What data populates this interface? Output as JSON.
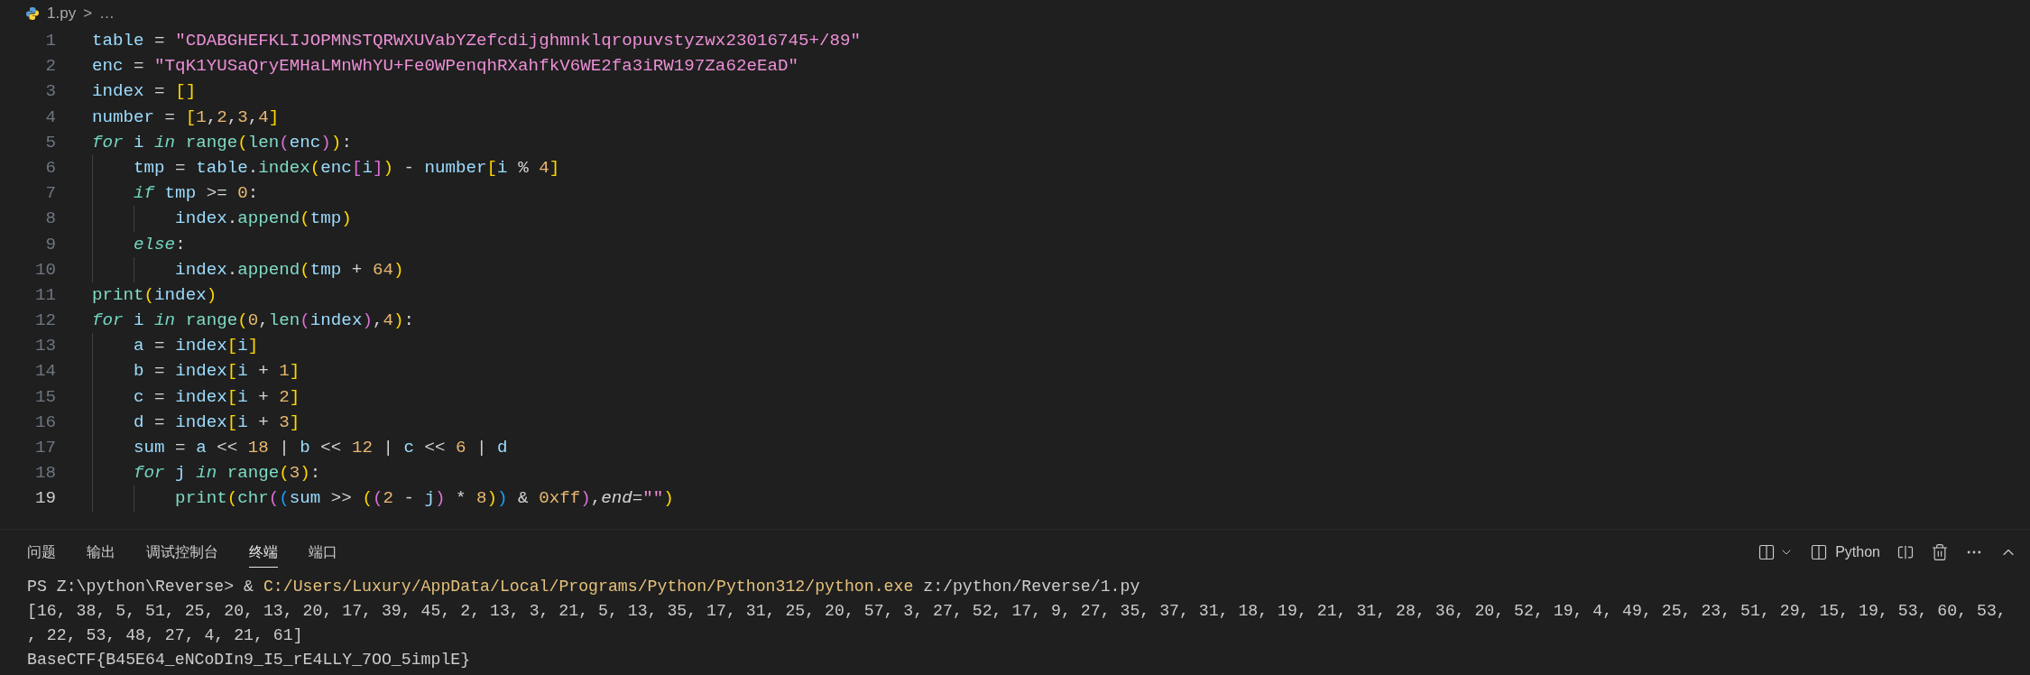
{
  "breadcrumb": {
    "file": "1.py",
    "separator": ">",
    "more": "…"
  },
  "code": [
    {
      "n": "1",
      "current": false,
      "tokens": [
        {
          "text": "table",
          "kind": "v"
        },
        {
          "text": " = ",
          "kind": "o"
        },
        {
          "text": "\"CDABGHEFKLIJOPMNSTQRWXUVabYZefcdijghmnklqropuvstyzwx23016745+/89\"",
          "kind": "s"
        }
      ]
    },
    {
      "n": "2",
      "current": false,
      "tokens": [
        {
          "text": "enc",
          "kind": "v"
        },
        {
          "text": " = ",
          "kind": "o"
        },
        {
          "text": "\"TqK1YUSaQryEMHaLMnWhYU+Fe0WPenqhRXahfkV6WE2fa3iRW197Za62eEaD\"",
          "kind": "s"
        }
      ]
    },
    {
      "n": "3",
      "current": false,
      "tokens": [
        {
          "text": "index",
          "kind": "v"
        },
        {
          "text": " = ",
          "kind": "o"
        },
        {
          "text": "[]",
          "kind": "b1"
        }
      ]
    },
    {
      "n": "4",
      "current": false,
      "tokens": [
        {
          "text": "number",
          "kind": "v"
        },
        {
          "text": " = ",
          "kind": "o"
        },
        {
          "text": "[",
          "kind": "b1"
        },
        {
          "text": "1",
          "kind": "n"
        },
        {
          "text": ",",
          "kind": "o"
        },
        {
          "text": "2",
          "kind": "n"
        },
        {
          "text": ",",
          "kind": "o"
        },
        {
          "text": "3",
          "kind": "n"
        },
        {
          "text": ",",
          "kind": "o"
        },
        {
          "text": "4",
          "kind": "n"
        },
        {
          "text": "]",
          "kind": "b1"
        }
      ]
    },
    {
      "n": "5",
      "current": false,
      "tokens": [
        {
          "text": "for",
          "kind": "k"
        },
        {
          "text": " i ",
          "kind": "v"
        },
        {
          "text": "in",
          "kind": "k"
        },
        {
          "text": " range",
          "kind": "f"
        },
        {
          "text": "(",
          "kind": "b1"
        },
        {
          "text": "len",
          "kind": "f"
        },
        {
          "text": "(",
          "kind": "b2"
        },
        {
          "text": "enc",
          "kind": "v"
        },
        {
          "text": ")",
          "kind": "b2"
        },
        {
          "text": ")",
          "kind": "b1"
        },
        {
          "text": ":",
          "kind": "o"
        }
      ]
    },
    {
      "n": "6",
      "current": false,
      "tokens": [
        {
          "text": "    tmp",
          "kind": "v"
        },
        {
          "text": " = ",
          "kind": "o"
        },
        {
          "text": "table",
          "kind": "v"
        },
        {
          "text": ".",
          "kind": "o"
        },
        {
          "text": "index",
          "kind": "f"
        },
        {
          "text": "(",
          "kind": "b1"
        },
        {
          "text": "enc",
          "kind": "v"
        },
        {
          "text": "[",
          "kind": "b2"
        },
        {
          "text": "i",
          "kind": "v"
        },
        {
          "text": "]",
          "kind": "b2"
        },
        {
          "text": ")",
          "kind": "b1"
        },
        {
          "text": " - ",
          "kind": "o"
        },
        {
          "text": "number",
          "kind": "v"
        },
        {
          "text": "[",
          "kind": "b1"
        },
        {
          "text": "i",
          "kind": "v"
        },
        {
          "text": " % ",
          "kind": "o"
        },
        {
          "text": "4",
          "kind": "n"
        },
        {
          "text": "]",
          "kind": "b1"
        }
      ]
    },
    {
      "n": "7",
      "current": false,
      "tokens": [
        {
          "text": "    if",
          "kind": "k"
        },
        {
          "text": " tmp",
          "kind": "v"
        },
        {
          "text": " >= ",
          "kind": "o"
        },
        {
          "text": "0",
          "kind": "n"
        },
        {
          "text": ":",
          "kind": "o"
        }
      ]
    },
    {
      "n": "8",
      "current": false,
      "tokens": [
        {
          "text": "        index",
          "kind": "v"
        },
        {
          "text": ".",
          "kind": "o"
        },
        {
          "text": "append",
          "kind": "f"
        },
        {
          "text": "(",
          "kind": "b1"
        },
        {
          "text": "tmp",
          "kind": "v"
        },
        {
          "text": ")",
          "kind": "b1"
        }
      ]
    },
    {
      "n": "9",
      "current": false,
      "tokens": [
        {
          "text": "    else",
          "kind": "k"
        },
        {
          "text": ":",
          "kind": "o"
        }
      ]
    },
    {
      "n": "10",
      "current": false,
      "tokens": [
        {
          "text": "        index",
          "kind": "v"
        },
        {
          "text": ".",
          "kind": "o"
        },
        {
          "text": "append",
          "kind": "f"
        },
        {
          "text": "(",
          "kind": "b1"
        },
        {
          "text": "tmp",
          "kind": "v"
        },
        {
          "text": " + ",
          "kind": "o"
        },
        {
          "text": "64",
          "kind": "n"
        },
        {
          "text": ")",
          "kind": "b1"
        }
      ]
    },
    {
      "n": "11",
      "current": false,
      "tokens": [
        {
          "text": "print",
          "kind": "f"
        },
        {
          "text": "(",
          "kind": "b1"
        },
        {
          "text": "index",
          "kind": "v"
        },
        {
          "text": ")",
          "kind": "b1"
        }
      ]
    },
    {
      "n": "12",
      "current": false,
      "tokens": [
        {
          "text": "for",
          "kind": "k"
        },
        {
          "text": " i ",
          "kind": "v"
        },
        {
          "text": "in",
          "kind": "k"
        },
        {
          "text": " range",
          "kind": "f"
        },
        {
          "text": "(",
          "kind": "b1"
        },
        {
          "text": "0",
          "kind": "n"
        },
        {
          "text": ",",
          "kind": "o"
        },
        {
          "text": "len",
          "kind": "f"
        },
        {
          "text": "(",
          "kind": "b2"
        },
        {
          "text": "index",
          "kind": "v"
        },
        {
          "text": ")",
          "kind": "b2"
        },
        {
          "text": ",",
          "kind": "o"
        },
        {
          "text": "4",
          "kind": "n"
        },
        {
          "text": ")",
          "kind": "b1"
        },
        {
          "text": ":",
          "kind": "o"
        }
      ]
    },
    {
      "n": "13",
      "current": false,
      "tokens": [
        {
          "text": "    a",
          "kind": "v"
        },
        {
          "text": " = ",
          "kind": "o"
        },
        {
          "text": "index",
          "kind": "v"
        },
        {
          "text": "[",
          "kind": "b1"
        },
        {
          "text": "i",
          "kind": "v"
        },
        {
          "text": "]",
          "kind": "b1"
        }
      ]
    },
    {
      "n": "14",
      "current": false,
      "tokens": [
        {
          "text": "    b",
          "kind": "v"
        },
        {
          "text": " = ",
          "kind": "o"
        },
        {
          "text": "index",
          "kind": "v"
        },
        {
          "text": "[",
          "kind": "b1"
        },
        {
          "text": "i",
          "kind": "v"
        },
        {
          "text": " + ",
          "kind": "o"
        },
        {
          "text": "1",
          "kind": "n"
        },
        {
          "text": "]",
          "kind": "b1"
        }
      ]
    },
    {
      "n": "15",
      "current": false,
      "tokens": [
        {
          "text": "    c",
          "kind": "v"
        },
        {
          "text": " = ",
          "kind": "o"
        },
        {
          "text": "index",
          "kind": "v"
        },
        {
          "text": "[",
          "kind": "b1"
        },
        {
          "text": "i",
          "kind": "v"
        },
        {
          "text": " + ",
          "kind": "o"
        },
        {
          "text": "2",
          "kind": "n"
        },
        {
          "text": "]",
          "kind": "b1"
        }
      ]
    },
    {
      "n": "16",
      "current": false,
      "tokens": [
        {
          "text": "    d",
          "kind": "v"
        },
        {
          "text": " = ",
          "kind": "o"
        },
        {
          "text": "index",
          "kind": "v"
        },
        {
          "text": "[",
          "kind": "b1"
        },
        {
          "text": "i",
          "kind": "v"
        },
        {
          "text": " + ",
          "kind": "o"
        },
        {
          "text": "3",
          "kind": "n"
        },
        {
          "text": "]",
          "kind": "b1"
        }
      ]
    },
    {
      "n": "17",
      "current": false,
      "tokens": [
        {
          "text": "    sum",
          "kind": "v"
        },
        {
          "text": " = ",
          "kind": "o"
        },
        {
          "text": "a",
          "kind": "v"
        },
        {
          "text": " << ",
          "kind": "o"
        },
        {
          "text": "18",
          "kind": "n"
        },
        {
          "text": " | ",
          "kind": "o"
        },
        {
          "text": "b",
          "kind": "v"
        },
        {
          "text": " << ",
          "kind": "o"
        },
        {
          "text": "12",
          "kind": "n"
        },
        {
          "text": " | ",
          "kind": "o"
        },
        {
          "text": "c",
          "kind": "v"
        },
        {
          "text": " << ",
          "kind": "o"
        },
        {
          "text": "6",
          "kind": "n"
        },
        {
          "text": " | ",
          "kind": "o"
        },
        {
          "text": "d",
          "kind": "v"
        }
      ]
    },
    {
      "n": "18",
      "current": false,
      "tokens": [
        {
          "text": "    for",
          "kind": "k"
        },
        {
          "text": " j ",
          "kind": "v"
        },
        {
          "text": "in",
          "kind": "k"
        },
        {
          "text": " range",
          "kind": "f"
        },
        {
          "text": "(",
          "kind": "b1"
        },
        {
          "text": "3",
          "kind": "n"
        },
        {
          "text": ")",
          "kind": "b1"
        },
        {
          "text": ":",
          "kind": "o"
        }
      ]
    },
    {
      "n": "19",
      "current": true,
      "tokens": [
        {
          "text": "        print",
          "kind": "f"
        },
        {
          "text": "(",
          "kind": "b1"
        },
        {
          "text": "chr",
          "kind": "f"
        },
        {
          "text": "(",
          "kind": "b2"
        },
        {
          "text": "(",
          "kind": "b3"
        },
        {
          "text": "sum",
          "kind": "v"
        },
        {
          "text": " >> ",
          "kind": "o"
        },
        {
          "text": "(",
          "kind": "b1"
        },
        {
          "text": "(",
          "kind": "b2"
        },
        {
          "text": "2",
          "kind": "n"
        },
        {
          "text": " - ",
          "kind": "o"
        },
        {
          "text": "j",
          "kind": "v"
        },
        {
          "text": ")",
          "kind": "b2"
        },
        {
          "text": " * ",
          "kind": "o"
        },
        {
          "text": "8",
          "kind": "n"
        },
        {
          "text": ")",
          "kind": "b1"
        },
        {
          "text": ")",
          "kind": "b3"
        },
        {
          "text": " & ",
          "kind": "o"
        },
        {
          "text": "0xff",
          "kind": "n"
        },
        {
          "text": ")",
          "kind": "b2"
        },
        {
          "text": ",",
          "kind": "o"
        },
        {
          "text": "end",
          "kind": "p"
        },
        {
          "text": "=",
          "kind": "o"
        },
        {
          "text": "\"\"",
          "kind": "s"
        },
        {
          "text": ")",
          "kind": "b1"
        }
      ]
    }
  ],
  "panel_tabs": [
    {
      "label": "问题",
      "selected": false
    },
    {
      "label": "输出",
      "selected": false
    },
    {
      "label": "调试控制台",
      "selected": false
    },
    {
      "label": "终端",
      "selected": true
    },
    {
      "label": "端口",
      "selected": false
    }
  ],
  "terminal_profile": "Python",
  "terminal": [
    [
      {
        "text": "PS Z:\\python\\Reverse> & ",
        "kind": "plain"
      },
      {
        "text": "C:/Users/Luxury/AppData/Local/Programs/Python/Python312/python.exe",
        "kind": "path"
      },
      {
        "text": " z:/python/Reverse/1.py",
        "kind": "plain"
      }
    ],
    [
      {
        "text": "[16, 38, 5, 51, 25, 20, 13, 20, 17, 39, 45, 2, 13, 3, 21, 5, 13, 35, 17, 31, 25, 20, 57, 3, 27, 52, 17, 9, 27, 35, 37, 31, 18, 19, 21, 31, 28, 36, 20, 52, 19, 4, 49, 25, 23, 51, 29, 15, 19, 53, 60, 53,",
        "kind": "plain"
      }
    ],
    [
      {
        "text": ", 22, 53, 48, 27, 4, 21, 61]",
        "kind": "plain"
      }
    ],
    [
      {
        "text": "BaseCTF{B45E64_eNCoDIn9_I5_rE4LLY_7OO_5implE}",
        "kind": "plain"
      }
    ]
  ]
}
